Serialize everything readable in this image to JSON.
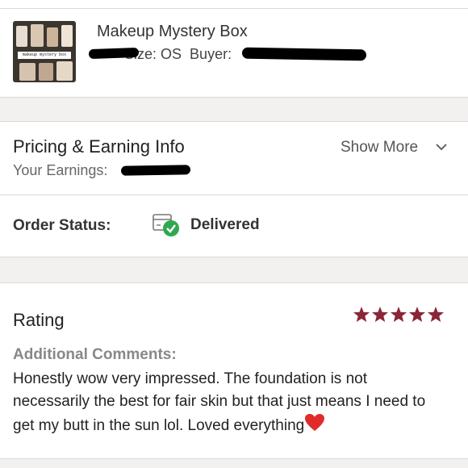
{
  "item": {
    "title": "Makeup Mystery Box",
    "size_text": "Size: OS",
    "buyer_text": "Buyer:",
    "thumbnail_caption": "makeup mystery box"
  },
  "pricing": {
    "heading": "Pricing & Earning Info",
    "earnings_label": "Your Earnings:",
    "show_more": "Show More",
    "chevron_icon": "chevron-down-icon"
  },
  "order": {
    "status_label": "Order Status:",
    "status_value": "Delivered",
    "status_icon": "delivered-box-icon",
    "status_color": "#2fa84f"
  },
  "rating": {
    "label": "Rating",
    "stars": 5,
    "star_color": "#8b2638",
    "comments_label": "Additional Comments:",
    "comments": "Honestly wow very impressed. The foundation is not necessarily the best for fair skin but that just means I need to get my butt in the sun lol. Loved everything"
  }
}
